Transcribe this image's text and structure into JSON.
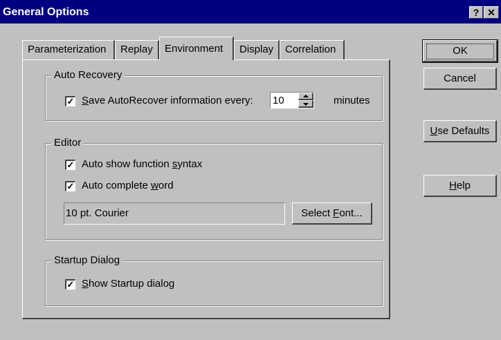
{
  "window": {
    "title": "General Options",
    "help_glyph": "?",
    "close_glyph": "✕"
  },
  "tabs": [
    {
      "label": "Parameterization"
    },
    {
      "label": "Replay"
    },
    {
      "label": "Environment"
    },
    {
      "label": "Display"
    },
    {
      "label": "Correlation"
    }
  ],
  "active_tab": "Environment",
  "auto_recovery": {
    "group_label": "Auto Recovery",
    "checkbox_prefix": "S",
    "checkbox_rest": "ave AutoRecover information every:",
    "checked": true,
    "minutes_value": "10",
    "minutes_label": "minutes"
  },
  "editor": {
    "group_label": "Editor",
    "syntax_prefix": "Auto show function ",
    "syntax_u": "s",
    "syntax_rest": "yntax",
    "syntax_checked": true,
    "word_prefix": "Auto complete ",
    "word_u": "w",
    "word_rest": "ord",
    "word_checked": true,
    "font_value": "10 pt.  Courier",
    "select_font_prefix": "Select ",
    "select_font_u": "F",
    "select_font_rest": "ont..."
  },
  "startup": {
    "group_label": "Startup Dialog",
    "show_u": "S",
    "show_rest": "how Startup dialog",
    "checked": true
  },
  "buttons": {
    "ok": "OK",
    "cancel": "Cancel",
    "use_defaults_u": "U",
    "use_defaults_rest": "se Defaults",
    "help_u": "H",
    "help_rest": "elp"
  },
  "check_glyph": "✓"
}
